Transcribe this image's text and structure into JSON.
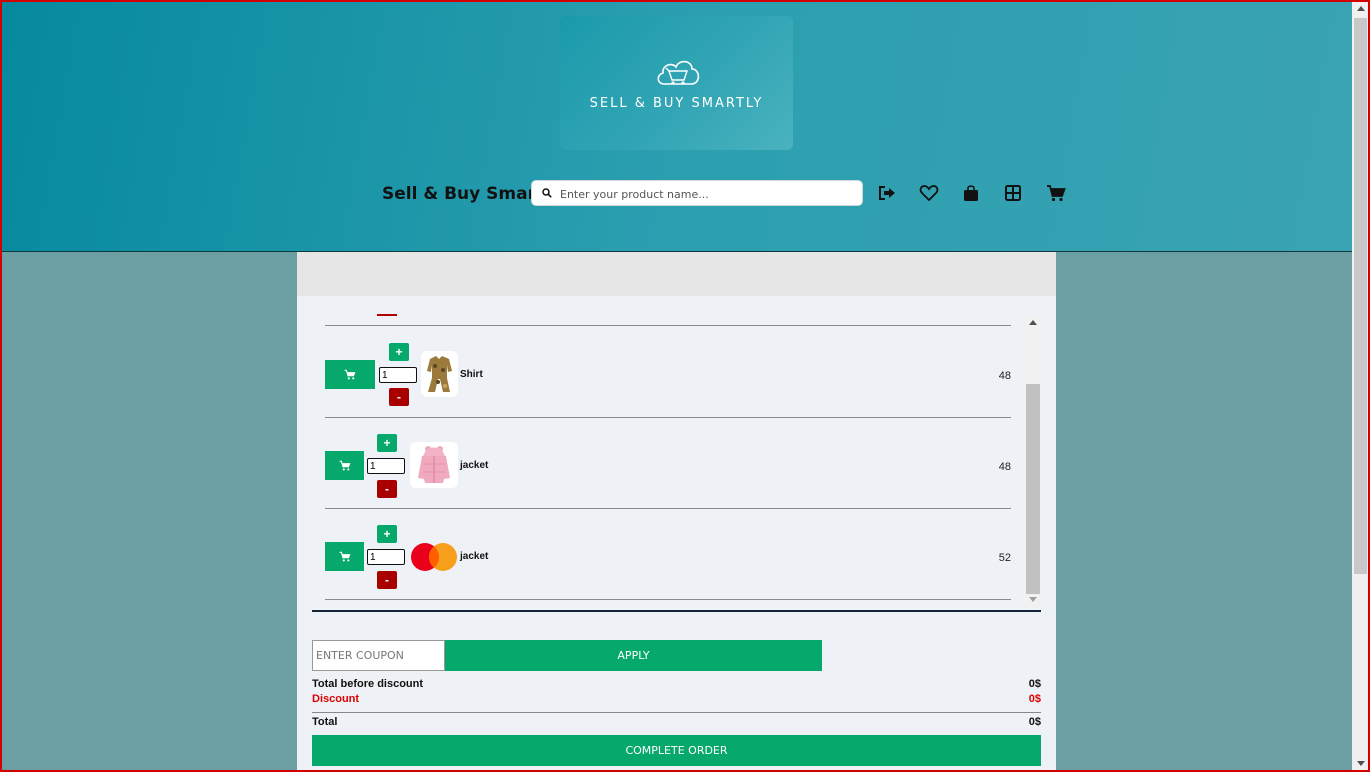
{
  "header": {
    "logo_text": "SELL & BUY SMARTLY",
    "brand_name": "Sell & Buy Smartly",
    "search": {
      "placeholder": "Enter your product name..."
    },
    "nav_icons": [
      "sign-out-icon",
      "heart-icon",
      "shopping-bag-icon",
      "grid-icon",
      "cart-icon"
    ]
  },
  "cart": {
    "items": [
      {
        "name": "Shirt",
        "quantity": "1",
        "price": "48",
        "plus_label": "+",
        "minus_label": "-"
      },
      {
        "name": "jacket",
        "quantity": "1",
        "price": "48",
        "plus_label": "+",
        "minus_label": "-"
      },
      {
        "name": "jacket",
        "quantity": "1",
        "price": "52",
        "plus_label": "+",
        "minus_label": "-"
      }
    ]
  },
  "coupon": {
    "placeholder": "ENTER COUPON",
    "apply_label": "APPLY"
  },
  "summary": {
    "total_before_label": "Total before discount",
    "total_before_value": "0$",
    "discount_label": "Discount",
    "discount_value": "0$",
    "total_label": "Total",
    "total_value": "0$"
  },
  "complete_order_label": "COMPLETE ORDER",
  "colors": {
    "accent": "#07a86c",
    "danger": "#a80000",
    "discount": "#e00000",
    "header": "#1b95a8"
  }
}
